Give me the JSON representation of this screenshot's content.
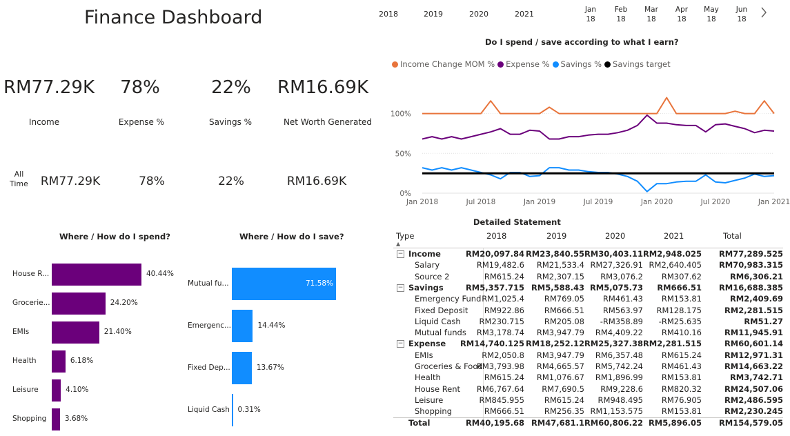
{
  "dashboard": {
    "title": "Finance Dashboard"
  },
  "kpis": [
    {
      "value": "RM77.29K",
      "label": "Income",
      "all_time": "RM77.29K"
    },
    {
      "value": "78%",
      "label": "Expense %",
      "all_time": "78%"
    },
    {
      "value": "22%",
      "label": "Savings %",
      "all_time": "22%"
    },
    {
      "value": "RM16.69K",
      "label": "Net Worth Generated",
      "all_time": "RM16.69K"
    }
  ],
  "all_time_label": [
    "All",
    "Time"
  ],
  "timeline": {
    "years": [
      "2018",
      "2019",
      "2020",
      "2021"
    ],
    "months": [
      {
        "m": "Jan",
        "y": "18"
      },
      {
        "m": "Feb",
        "y": "18"
      },
      {
        "m": "Mar",
        "y": "18"
      },
      {
        "m": "Apr",
        "y": "18"
      },
      {
        "m": "May",
        "y": "18"
      },
      {
        "m": "Jun",
        "y": "18"
      }
    ],
    "next_icon": "chevron-right-icon"
  },
  "line_chart": {
    "title": "Do I spend / save according to what I earn?",
    "legend": [
      {
        "name": "Income Change MOM %",
        "color": "#E8743B"
      },
      {
        "name": "Expense %",
        "color": "#6B007B"
      },
      {
        "name": "Savings %",
        "color": "#118DFF"
      },
      {
        "name": "Savings target",
        "color": "#000000"
      }
    ],
    "y_ticks": [
      "0%",
      "50%",
      "100%"
    ],
    "x_ticks": [
      "Jan 2018",
      "Jul 2018",
      "Jan 2019",
      "Jul 2019",
      "Jan 2020",
      "Jul 2020",
      "Jan 2021"
    ]
  },
  "chart_data": [
    {
      "type": "line",
      "title": "Do I spend / save according to what I earn?",
      "x": [
        "Jan 2018",
        "Feb 2018",
        "Mar 2018",
        "Apr 2018",
        "May 2018",
        "Jun 2018",
        "Jul 2018",
        "Aug 2018",
        "Sep 2018",
        "Oct 2018",
        "Nov 2018",
        "Dec 2018",
        "Jan 2019",
        "Feb 2019",
        "Mar 2019",
        "Apr 2019",
        "May 2019",
        "Jun 2019",
        "Jul 2019",
        "Aug 2019",
        "Sep 2019",
        "Oct 2019",
        "Nov 2019",
        "Dec 2019",
        "Jan 2020",
        "Feb 2020",
        "Mar 2020",
        "Apr 2020",
        "May 2020",
        "Jun 2020",
        "Jul 2020",
        "Aug 2020",
        "Sep 2020",
        "Oct 2020",
        "Nov 2020",
        "Dec 2020",
        "Jan 2021"
      ],
      "ylim": [
        0,
        1.3
      ],
      "series": [
        {
          "name": "Income Change MOM %",
          "values": [
            1.0,
            1.0,
            1.0,
            1.0,
            1.0,
            1.0,
            1.0,
            1.16,
            1.0,
            1.0,
            1.0,
            1.0,
            1.0,
            1.08,
            1.0,
            1.0,
            1.0,
            1.0,
            1.0,
            1.0,
            1.0,
            1.0,
            1.0,
            1.0,
            1.0,
            1.2,
            1.0,
            1.0,
            1.0,
            1.0,
            1.0,
            1.0,
            1.03,
            1.0,
            1.0,
            1.16,
            1.0
          ]
        },
        {
          "name": "Expense %",
          "values": [
            0.68,
            0.71,
            0.68,
            0.71,
            0.68,
            0.71,
            0.74,
            0.77,
            0.81,
            0.74,
            0.74,
            0.79,
            0.78,
            0.68,
            0.68,
            0.71,
            0.71,
            0.73,
            0.74,
            0.74,
            0.76,
            0.79,
            0.85,
            0.98,
            0.88,
            0.88,
            0.86,
            0.85,
            0.85,
            0.77,
            0.86,
            0.87,
            0.84,
            0.81,
            0.76,
            0.79,
            0.78
          ]
        },
        {
          "name": "Savings %",
          "values": [
            0.32,
            0.29,
            0.32,
            0.29,
            0.32,
            0.29,
            0.26,
            0.23,
            0.18,
            0.26,
            0.26,
            0.21,
            0.22,
            0.32,
            0.32,
            0.29,
            0.29,
            0.27,
            0.26,
            0.26,
            0.24,
            0.21,
            0.15,
            0.02,
            0.12,
            0.12,
            0.14,
            0.15,
            0.15,
            0.23,
            0.14,
            0.13,
            0.16,
            0.19,
            0.24,
            0.21,
            0.22
          ]
        },
        {
          "name": "Savings target",
          "values": [
            0.25,
            0.25,
            0.25,
            0.25,
            0.25,
            0.25,
            0.25,
            0.25,
            0.25,
            0.25,
            0.25,
            0.25,
            0.25,
            0.25,
            0.25,
            0.25,
            0.25,
            0.25,
            0.25,
            0.25,
            0.25,
            0.25,
            0.25,
            0.25,
            0.25,
            0.25,
            0.25,
            0.25,
            0.25,
            0.25,
            0.25,
            0.25,
            0.25,
            0.25,
            0.25,
            0.25,
            0.25
          ]
        }
      ]
    },
    {
      "type": "bar",
      "title": "Where / How do I spend?",
      "categories": [
        "House R...",
        "Grocerie...",
        "EMIs",
        "Health",
        "Leisure",
        "Shopping"
      ],
      "values": [
        40.44,
        24.2,
        21.4,
        6.18,
        4.1,
        3.68
      ],
      "labels": [
        "40.44%",
        "24.20%",
        "21.40%",
        "6.18%",
        "4.10%",
        "3.68%"
      ],
      "color": "#6B007B"
    },
    {
      "type": "bar",
      "title": "Where / How do I save?",
      "categories": [
        "Mutual fu...",
        "Emergenc...",
        "Fixed Dep...",
        "Liquid Cash"
      ],
      "values": [
        71.58,
        14.44,
        13.67,
        0.31
      ],
      "labels": [
        "71.58%",
        "14.44%",
        "13.67%",
        "0.31%"
      ],
      "color": "#118DFF"
    }
  ],
  "statement": {
    "title": "Detailed Statement",
    "columns": [
      "Type",
      "2018",
      "2019",
      "2020",
      "2021",
      "Total"
    ],
    "rows": [
      {
        "label": "Income",
        "level": 0,
        "bold": true,
        "expand": "⊟",
        "values": [
          "RM20,097.84",
          "RM23,840.55",
          "RM30,403.11",
          "RM2,948.025",
          "RM77,289.525"
        ]
      },
      {
        "label": "Salary",
        "level": 1,
        "bold": false,
        "values": [
          "RM19,482.6",
          "RM21,533.4",
          "RM27,326.91",
          "RM2,640.405",
          "RM70,983.315"
        ]
      },
      {
        "label": "Source 2",
        "level": 1,
        "bold": false,
        "values": [
          "RM615.24",
          "RM2,307.15",
          "RM3,076.2",
          "RM307.62",
          "RM6,306.21"
        ]
      },
      {
        "label": "Savings",
        "level": 0,
        "bold": true,
        "expand": "⊟",
        "values": [
          "RM5,357.715",
          "RM5,588.43",
          "RM5,075.73",
          "RM666.51",
          "RM16,688.385"
        ]
      },
      {
        "label": "Emergency Fund",
        "level": 1,
        "bold": false,
        "values": [
          "RM1,025.4",
          "RM769.05",
          "RM461.43",
          "RM153.81",
          "RM2,409.69"
        ]
      },
      {
        "label": "Fixed Deposit",
        "level": 1,
        "bold": false,
        "values": [
          "RM922.86",
          "RM666.51",
          "RM563.97",
          "RM128.175",
          "RM2,281.515"
        ]
      },
      {
        "label": "Liquid Cash",
        "level": 1,
        "bold": false,
        "values": [
          "RM230.715",
          "RM205.08",
          "-RM358.89",
          "-RM25.635",
          "RM51.27"
        ]
      },
      {
        "label": "Mutual funds",
        "level": 1,
        "bold": false,
        "values": [
          "RM3,178.74",
          "RM3,947.79",
          "RM4,409.22",
          "RM410.16",
          "RM11,945.91"
        ]
      },
      {
        "label": "Expense",
        "level": 0,
        "bold": true,
        "expand": "⊟",
        "values": [
          "RM14,740.125",
          "RM18,252.12",
          "RM25,327.38",
          "RM2,281.515",
          "RM60,601.14"
        ]
      },
      {
        "label": "EMIs",
        "level": 1,
        "bold": false,
        "values": [
          "RM2,050.8",
          "RM3,947.79",
          "RM6,357.48",
          "RM615.24",
          "RM12,971.31"
        ]
      },
      {
        "label": "Groceries & Food",
        "level": 1,
        "bold": false,
        "values": [
          "RM3,793.98",
          "RM4,665.57",
          "RM5,742.24",
          "RM461.43",
          "RM14,663.22"
        ]
      },
      {
        "label": "Health",
        "level": 1,
        "bold": false,
        "values": [
          "RM615.24",
          "RM1,076.67",
          "RM1,896.99",
          "RM153.81",
          "RM3,742.71"
        ]
      },
      {
        "label": "House Rent",
        "level": 1,
        "bold": false,
        "values": [
          "RM6,767.64",
          "RM7,690.5",
          "RM9,228.6",
          "RM820.32",
          "RM24,507.06"
        ]
      },
      {
        "label": "Leisure",
        "level": 1,
        "bold": false,
        "values": [
          "RM845.955",
          "RM615.24",
          "RM948.495",
          "RM76.905",
          "RM2,486.595"
        ]
      },
      {
        "label": "Shopping",
        "level": 1,
        "bold": false,
        "values": [
          "RM666.51",
          "RM256.35",
          "RM1,153.575",
          "RM153.81",
          "RM2,230.245"
        ]
      },
      {
        "label": "Total",
        "level": 0,
        "bold": true,
        "values": [
          "RM40,195.68",
          "RM47,681.1",
          "RM60,806.22",
          "RM5,896.05",
          "RM154,579.05"
        ]
      }
    ]
  }
}
